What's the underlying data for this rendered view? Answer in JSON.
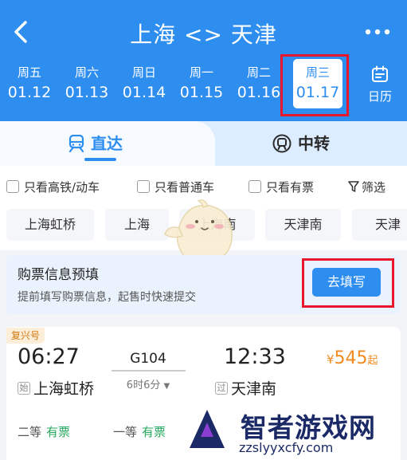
{
  "header": {
    "title": "上海 <> 天津",
    "calendar_label": "日历",
    "colors": {
      "header_bg": "#2d8ef0",
      "highlight_frame": "#e8172b"
    }
  },
  "days": [
    {
      "weekday": "周五",
      "date": "01.12"
    },
    {
      "weekday": "周六",
      "date": "01.13"
    },
    {
      "weekday": "周日",
      "date": "01.14"
    },
    {
      "weekday": "周一",
      "date": "01.15"
    },
    {
      "weekday": "周二",
      "date": "01.16"
    },
    {
      "weekday": "周三",
      "date": "01.17",
      "selected": true
    }
  ],
  "tabs": {
    "direct": "直达",
    "transfer": "中转"
  },
  "filters": {
    "high_speed": "只看高铁/动车",
    "regular": "只看普通车",
    "available": "只看有票",
    "screen": "筛选"
  },
  "stations": [
    "上海虹桥",
    "上海",
    "上海南",
    "天津南",
    "天津"
  ],
  "prefill": {
    "title": "购票信息预填",
    "subtitle": "提前填写购票信息，起售时快速提交",
    "button": "去填写"
  },
  "train": {
    "badge": "复兴号",
    "departure_time": "06:27",
    "arrival_time": "12:33",
    "number": "G104",
    "duration": "6时6分",
    "price_currency": "¥",
    "price_value": "545",
    "price_suffix": "起",
    "from_tag": "始",
    "from_station": "上海虹桥",
    "to_tag": "过",
    "to_station": "天津南",
    "seats": [
      {
        "class": "二等",
        "status": "有票"
      },
      {
        "class": "一等",
        "status": "有票"
      }
    ]
  },
  "watermark": {
    "name": "智者游戏网",
    "url": "zzslyyxcfy.com"
  }
}
